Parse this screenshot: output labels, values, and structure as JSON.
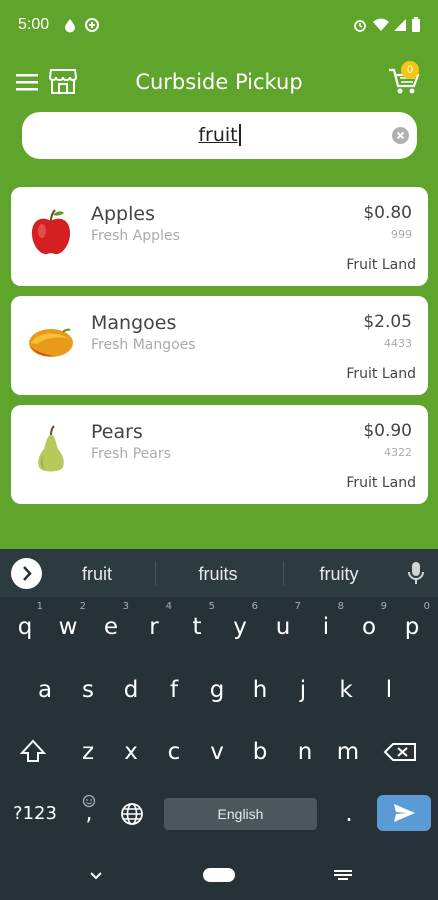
{
  "status": {
    "time": "5:00"
  },
  "appbar": {
    "title": "Curbside Pickup",
    "cart_count": "0"
  },
  "search": {
    "value": "fruit"
  },
  "products": [
    {
      "name": "Apples",
      "desc": "Fresh Apples",
      "price": "$0.80",
      "sku": "999",
      "vendor": "Fruit Land"
    },
    {
      "name": "Mangoes",
      "desc": "Fresh Mangoes",
      "price": "$2.05",
      "sku": "4433",
      "vendor": "Fruit Land"
    },
    {
      "name": "Pears",
      "desc": "Fresh Pears",
      "price": "$0.90",
      "sku": "4322",
      "vendor": "Fruit Land"
    }
  ],
  "keyboard": {
    "suggestions": [
      "fruit",
      "fruits",
      "fruity"
    ],
    "row1": [
      "q",
      "w",
      "e",
      "r",
      "t",
      "y",
      "u",
      "i",
      "o",
      "p"
    ],
    "row1_hints": [
      "1",
      "2",
      "3",
      "4",
      "5",
      "6",
      "7",
      "8",
      "9",
      "0"
    ],
    "row2": [
      "a",
      "s",
      "d",
      "f",
      "g",
      "h",
      "j",
      "k",
      "l"
    ],
    "row3": [
      "z",
      "x",
      "c",
      "v",
      "b",
      "n",
      "m"
    ],
    "symbols_label": "?123",
    "comma": ",",
    "period": ".",
    "space_label": "English"
  },
  "colors": {
    "app_green": "#5fa52c",
    "badge": "#f5c518",
    "enter_key": "#5b9bd5"
  }
}
